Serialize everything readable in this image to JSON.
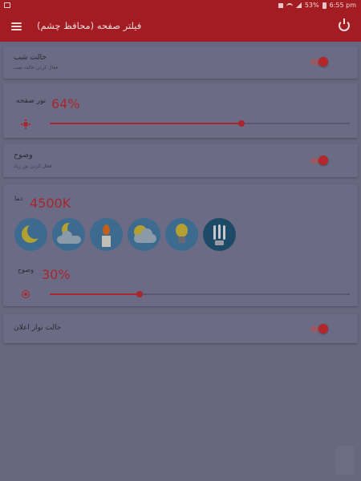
{
  "status_bar": {
    "battery": "53%",
    "time": "6:55 pm"
  },
  "app_bar": {
    "title": "فیلتر صفحه (محافظ چشم)"
  },
  "night_mode": {
    "title": "حالت شب",
    "subtitle": "فعال کردن حالت شب",
    "enabled": true
  },
  "screen_brightness": {
    "label": "نور صفحه",
    "value_text": "64%",
    "value": 64
  },
  "clarity_toggle": {
    "title": "وضوح",
    "subtitle": "فعال کردن نور زیاد",
    "enabled": true
  },
  "temperature": {
    "label": "دما",
    "value_text": "4500K",
    "presets": [
      {
        "icon": "moon-icon",
        "selected": false
      },
      {
        "icon": "moon-cloud-icon",
        "selected": false
      },
      {
        "icon": "candle-icon",
        "selected": false
      },
      {
        "icon": "sun-cloud-icon",
        "selected": false
      },
      {
        "icon": "lightbulb-icon",
        "selected": false
      },
      {
        "icon": "cfl-bulb-icon",
        "selected": true
      }
    ]
  },
  "clarity": {
    "label": "وضوح",
    "value_text": "30%",
    "value": 30
  },
  "notification_bar": {
    "title": "حالت نوار اعلان",
    "enabled": true
  },
  "colors": {
    "accent": "#a8262c",
    "app_bar": "#a31c22",
    "background": "#67677f"
  }
}
